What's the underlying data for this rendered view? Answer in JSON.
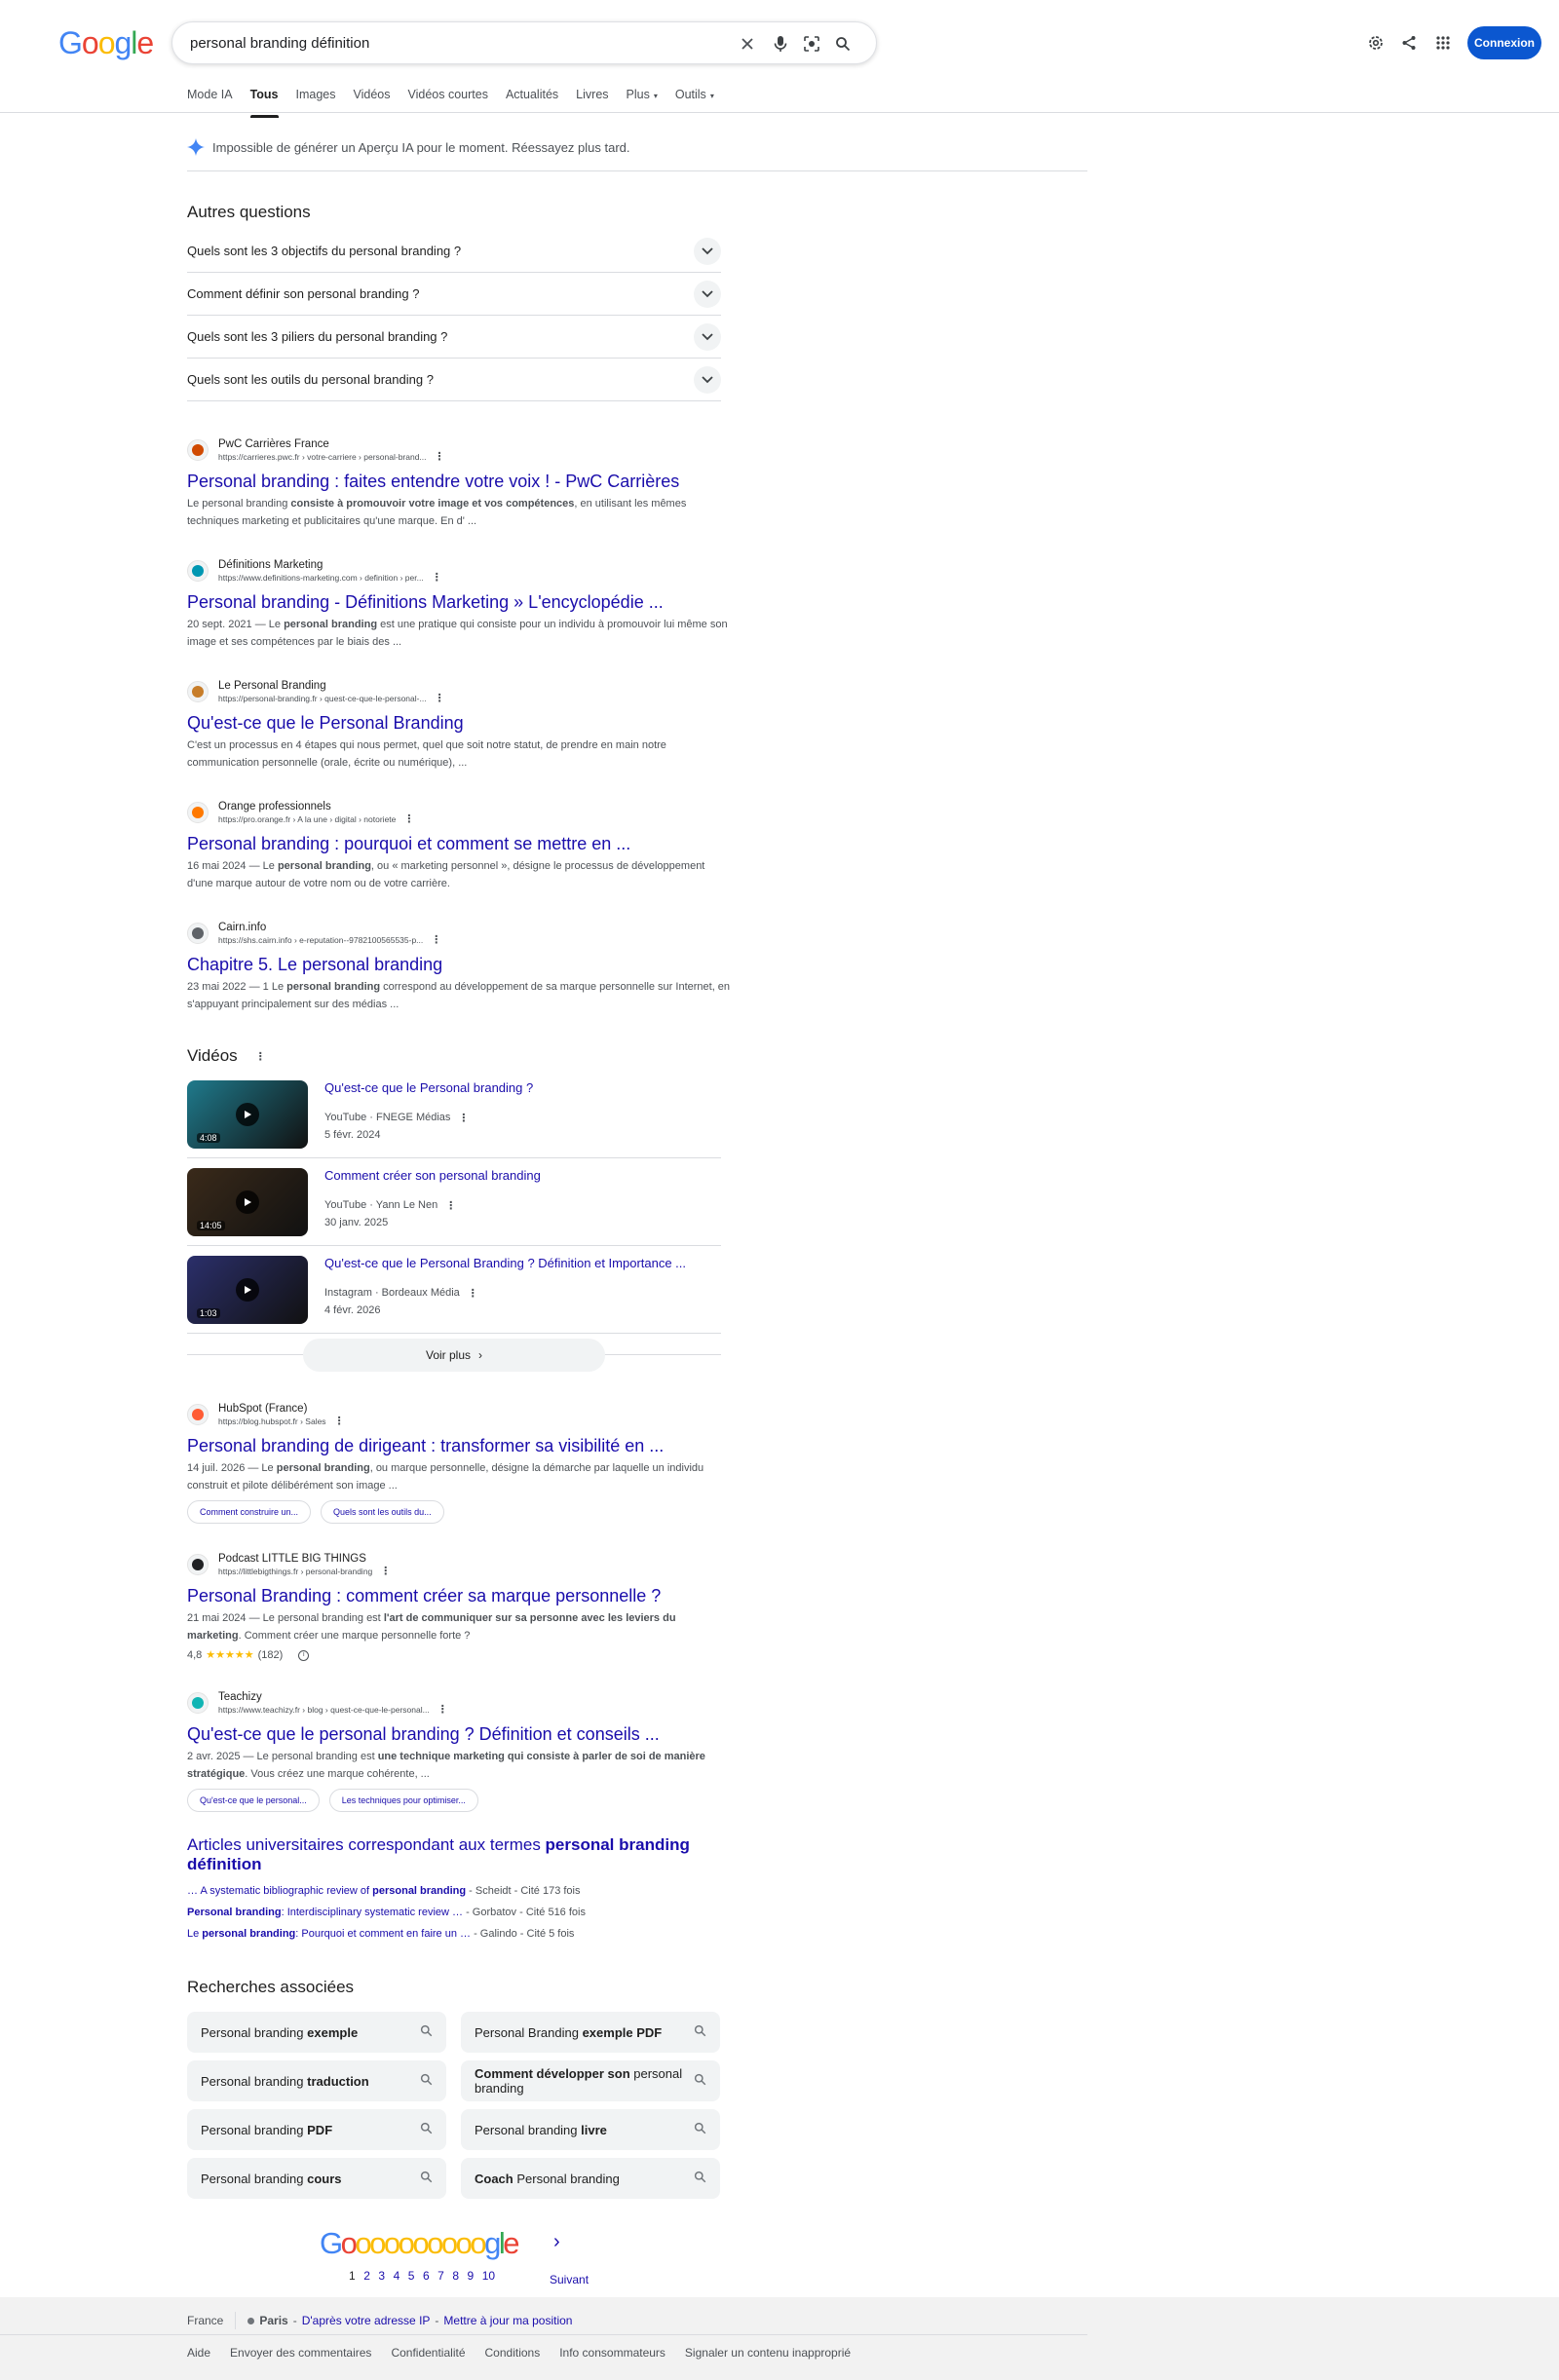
{
  "header": {
    "logo_letters": [
      {
        "ch": "G",
        "color": "#4285f4"
      },
      {
        "ch": "o",
        "color": "#ea4335"
      },
      {
        "ch": "o",
        "color": "#fbbc05"
      },
      {
        "ch": "g",
        "color": "#4285f4"
      },
      {
        "ch": "l",
        "color": "#34a853"
      },
      {
        "ch": "e",
        "color": "#ea4335"
      }
    ],
    "query": "personal branding définition",
    "signin_label": "Connexion"
  },
  "tabs": [
    {
      "label": "Mode IA",
      "active": false
    },
    {
      "label": "Tous",
      "active": true
    },
    {
      "label": "Images",
      "active": false
    },
    {
      "label": "Vidéos",
      "active": false
    },
    {
      "label": "Vidéos courtes",
      "active": false
    },
    {
      "label": "Actualités",
      "active": false
    },
    {
      "label": "Livres",
      "active": false
    },
    {
      "label": "Plus",
      "active": false
    },
    {
      "label": "Outils",
      "active": false
    }
  ],
  "ai_notice": "Impossible de générer un Aperçu IA pour le moment. Réessayez plus tard.",
  "paa": {
    "heading": "Autres questions",
    "questions": [
      "Quels sont les 3 objectifs du personal branding ?",
      "Comment définir son personal branding ?",
      "Quels sont les 3 piliers du personal branding ?",
      "Quels sont les outils du personal branding ?"
    ]
  },
  "results": [
    {
      "site": "PwC Carrières France",
      "url": "https://carrieres.pwc.fr › votre-carriere › personal-brand...",
      "title": "Personal branding : faites entendre votre voix ! - PwC Carrières",
      "snippet_pre": "Le personal branding ",
      "snippet_bold": "consiste à promouvoir votre image et vos compétences",
      "snippet_post": ", en utilisant les mêmes techniques marketing et publicitaires qu'une marque. En d' ..."
    },
    {
      "site": "Définitions Marketing",
      "url": "https://www.definitions-marketing.com › definition › per...",
      "title": "Personal branding - Définitions Marketing » L'encyclopédie ...",
      "snippet_pre": "20 sept. 2021 — Le ",
      "snippet_bold": "personal branding",
      "snippet_post": " est une pratique qui consiste pour un individu à promouvoir lui même son image et ses compétences par le biais des ..."
    },
    {
      "site": "Le Personal Branding",
      "url": "https://personal-branding.fr › quest-ce-que-le-personal-...",
      "title": "Qu'est-ce que le Personal Branding",
      "snippet_pre": "C'est un processus en 4 étapes qui nous permet, quel que soit notre statut, de prendre en main notre communication personnelle (orale, écrite ou numérique), ...",
      "snippet_bold": "",
      "snippet_post": ""
    },
    {
      "site": "Orange professionnels",
      "url": "https://pro.orange.fr › A la une › digital › notoriete",
      "title": "Personal branding : pourquoi et comment se mettre en ...",
      "snippet_pre": "16 mai 2024 — Le ",
      "snippet_bold": "personal branding",
      "snippet_post": ", ou « marketing personnel », désigne le processus de développement d'une marque autour de votre nom ou de votre carrière."
    },
    {
      "site": "Cairn.info",
      "url": "https://shs.cairn.info › e-reputation--9782100565535-p...",
      "title": "Chapitre 5. Le personal branding",
      "snippet_pre": "23 mai 2022 — 1 Le ",
      "snippet_bold": "personal branding",
      "snippet_post": " correspond au développement de sa marque personnelle sur Internet, en s'appuyant principalement sur des médias ..."
    }
  ],
  "videos": {
    "heading": "Vidéos",
    "items": [
      {
        "title": "Qu'est-ce que le Personal branding ?",
        "source": "YouTube · FNEGE Médias",
        "date": "5 févr. 2024",
        "duration": "4:08",
        "thumb_color": "#1f7a8c"
      },
      {
        "title": "Comment créer son personal branding",
        "source": "YouTube · Yann Le Nen",
        "date": "30 janv. 2025",
        "duration": "14:05",
        "thumb_color": "#3a2a1a"
      },
      {
        "title": "Qu'est-ce que le Personal Branding ? Définition et Importance ...",
        "source": "Instagram · Bordeaux Média",
        "date": "4 févr. 2026",
        "duration": "1:03",
        "thumb_color": "#2b2f6b"
      }
    ],
    "more_label": "Voir plus"
  },
  "results2": [
    {
      "site": "HubSpot (France)",
      "url": "https://blog.hubspot.fr › Sales",
      "title": "Personal branding de dirigeant : transformer sa visibilité en ...",
      "snippet_pre": "14 juil. 2026 — Le ",
      "snippet_bold": "personal branding",
      "snippet_post": ", ou marque personnelle, désigne la démarche par laquelle un individu construit et pilote délibérément son image ...",
      "chips": [
        "Comment construire un...",
        "Quels sont les outils du..."
      ]
    },
    {
      "site": "Podcast LITTLE BIG THINGS",
      "url": "https://littlebigthings.fr › personal-branding",
      "title": "Personal Branding : comment créer sa marque personnelle ?",
      "snippet_pre": "21 mai 2024 — Le personal branding est ",
      "snippet_bold": "l'art de communiquer sur sa personne avec les leviers du marketing",
      "snippet_post": ". Comment créer une marque personnelle forte ?",
      "rating": "4,8",
      "stars": "★★★★★",
      "reviews": "(182)"
    },
    {
      "site": "Teachizy",
      "url": "https://www.teachizy.fr › blog › quest-ce-que-le-personal...",
      "title": "Qu'est-ce que le personal branding ? Définition et conseils ...",
      "snippet_pre": "2 avr. 2025 — Le personal branding est ",
      "snippet_bold": "une technique marketing qui consiste à parler de soi de manière stratégique",
      "snippet_post": ". Vous créez une marque cohérente, ...",
      "chips": [
        "Qu'est-ce que le personal...",
        "Les techniques pour optimiser..."
      ]
    }
  ],
  "scholar": {
    "title_pre": "Articles universitaires correspondant aux termes ",
    "title_bold": "personal branding définition",
    "items": [
      {
        "pre": "… A systematic bibliographic review of ",
        "bold": "personal branding",
        "post": "",
        "meta": " - Scheidt - Cité 173 fois"
      },
      {
        "pre": "",
        "bold": "Personal branding",
        "post": ": Interdisciplinary systematic review …",
        "meta": " - Gorbatov - Cité 516 fois"
      },
      {
        "pre": "Le ",
        "bold": "personal branding",
        "post": ": Pourquoi et comment en faire un …",
        "meta": " - Galindo - Cité 5 fois"
      }
    ]
  },
  "related": {
    "heading": "Recherches associées",
    "items": [
      {
        "pre": "Personal branding ",
        "bold": "exemple",
        "post": ""
      },
      {
        "pre": "Personal Branding ",
        "bold": "exemple PDF",
        "post": ""
      },
      {
        "pre": "Personal branding ",
        "bold": "traduction",
        "post": ""
      },
      {
        "pre": "",
        "bold": "Comment développer son",
        "post": " personal branding"
      },
      {
        "pre": "Personal branding ",
        "bold": "PDF",
        "post": ""
      },
      {
        "pre": "Personal branding ",
        "bold": "livre",
        "post": ""
      },
      {
        "pre": "Personal branding ",
        "bold": "cours",
        "post": ""
      },
      {
        "pre": "",
        "bold": "Coach",
        "post": " Personal branding"
      }
    ]
  },
  "pagination": {
    "logo_letters": [
      {
        "ch": "G",
        "color": "#4285f4"
      },
      {
        "ch": "o",
        "color": "#ea4335"
      },
      {
        "ch": "o",
        "color": "#fbbc05"
      },
      {
        "ch": "o",
        "color": "#fbbc05"
      },
      {
        "ch": "o",
        "color": "#fbbc05"
      },
      {
        "ch": "o",
        "color": "#fbbc05"
      },
      {
        "ch": "o",
        "color": "#fbbc05"
      },
      {
        "ch": "o",
        "color": "#fbbc05"
      },
      {
        "ch": "o",
        "color": "#fbbc05"
      },
      {
        "ch": "o",
        "color": "#fbbc05"
      },
      {
        "ch": "o",
        "color": "#fbbc05"
      },
      {
        "ch": "g",
        "color": "#4285f4"
      },
      {
        "ch": "l",
        "color": "#34a853"
      },
      {
        "ch": "e",
        "color": "#ea4335"
      }
    ],
    "pages": [
      "1",
      "2",
      "3",
      "4",
      "5",
      "6",
      "7",
      "8",
      "9",
      "10"
    ],
    "current": "1",
    "next_label": "Suivant"
  },
  "footer": {
    "country": "France",
    "city": "Paris",
    "location_source": "D'après votre adresse IP",
    "update_location": "Mettre à jour ma position",
    "links": [
      "Aide",
      "Envoyer des commentaires",
      "Confidentialité",
      "Conditions",
      "Info consommateurs",
      "Signaler un contenu inapproprié"
    ]
  }
}
